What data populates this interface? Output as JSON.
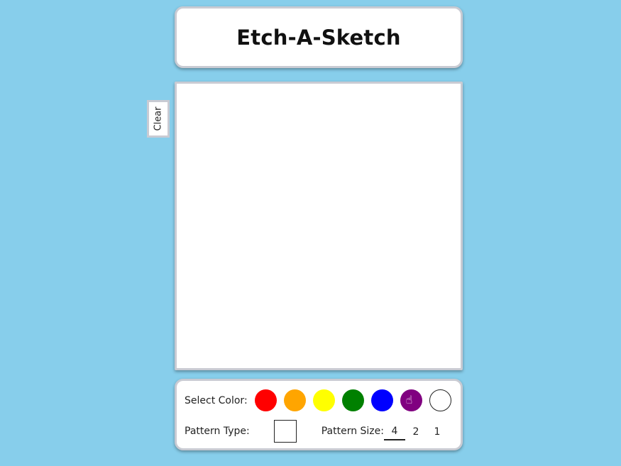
{
  "app": {
    "title": "Etch-A-Sketch"
  },
  "clear_button": {
    "label": "Clear"
  },
  "controls": {
    "select_color_label": "Select Color:",
    "colors": [
      {
        "name": "red",
        "hex": "#ff0000"
      },
      {
        "name": "orange",
        "hex": "#ffa500"
      },
      {
        "name": "yellow",
        "hex": "#ffff00"
      },
      {
        "name": "green",
        "hex": "#008000"
      },
      {
        "name": "blue",
        "hex": "#0000ff"
      },
      {
        "name": "purple",
        "hex": "#800080"
      },
      {
        "name": "white",
        "hex": "#ffffff"
      }
    ],
    "pattern_type_label": "Pattern Type:",
    "pattern_size_label": "Pattern Size:",
    "pattern_sizes": [
      "4",
      "2",
      "1"
    ],
    "selected_pattern_size": "4"
  },
  "theme": {
    "background": "#87ceeb",
    "card_border": "#c9cbd3"
  }
}
